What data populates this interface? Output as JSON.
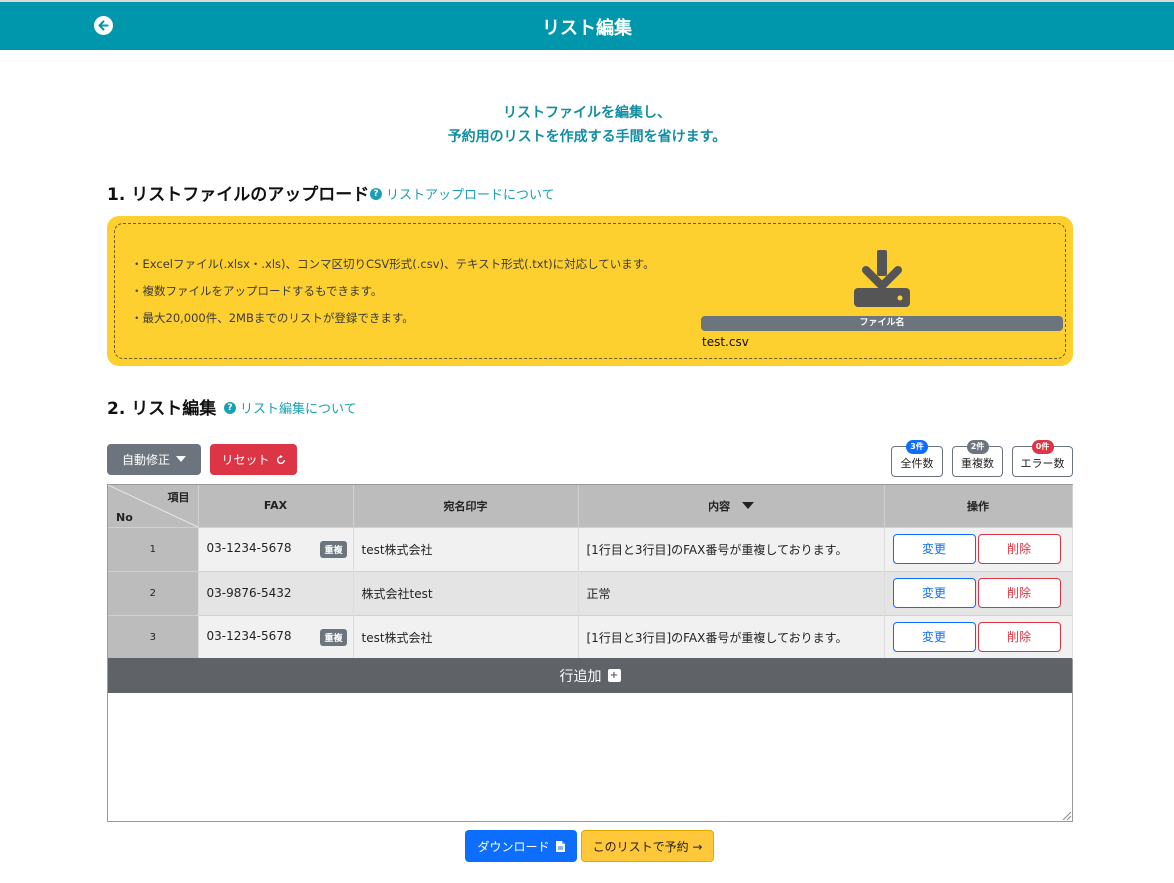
{
  "header": {
    "title": "リスト編集",
    "back_icon": "arrow-left-circle-icon"
  },
  "intro": {
    "line1": "リストファイルを編集し、",
    "line2": "予約用のリストを作成する手間を省けます。"
  },
  "upload_section": {
    "title": "1. リストファイルのアップロード",
    "help_link": "リストアップロードについて",
    "notes": [
      "・Excelファイル(.xlsx・.xls)、コンマ区切りCSV形式(.csv)、テキスト形式(.txt)に対応しています。",
      "・複数ファイルをアップロードするもできます。",
      "・最大20,000件、2MBまでのリストが登録できます。"
    ],
    "file_label": "ファイル名",
    "file_name": "test.csv",
    "icon": "download-tray-icon"
  },
  "edit_section": {
    "title": "2. リスト編集",
    "help_link": "リスト編集について"
  },
  "toolbar": {
    "auto_fix": "自動修正",
    "reset": "リセット"
  },
  "counts": [
    {
      "label": "全件数",
      "badge": "3件",
      "color": "#0d6efd"
    },
    {
      "label": "重複数",
      "badge": "2件",
      "color": "#6c757d"
    },
    {
      "label": "エラー数",
      "badge": "0件",
      "color": "#dc3545"
    }
  ],
  "table": {
    "corner_item": "項目",
    "corner_no": "No",
    "headers": {
      "fax": "FAX",
      "name": "宛名印字",
      "content": "内容",
      "ops": "操作"
    },
    "dup_label": "重複",
    "edit_label": "変更",
    "delete_label": "削除",
    "rows": [
      {
        "no": "1",
        "fax": "03-1234-5678",
        "dup": true,
        "name": "test株式会社",
        "content": "[1行目と3行目]のFAX番号が重複しております。"
      },
      {
        "no": "2",
        "fax": "03-9876-5432",
        "dup": false,
        "name": "株式会社test",
        "content": "正常"
      },
      {
        "no": "3",
        "fax": "03-1234-5678",
        "dup": true,
        "name": "test株式会社",
        "content": "[1行目と3行目]のFAX番号が重複しております。"
      }
    ],
    "add_row": "行追加"
  },
  "footer": {
    "download": "ダウンロード",
    "reserve": "このリストで予約 →"
  }
}
